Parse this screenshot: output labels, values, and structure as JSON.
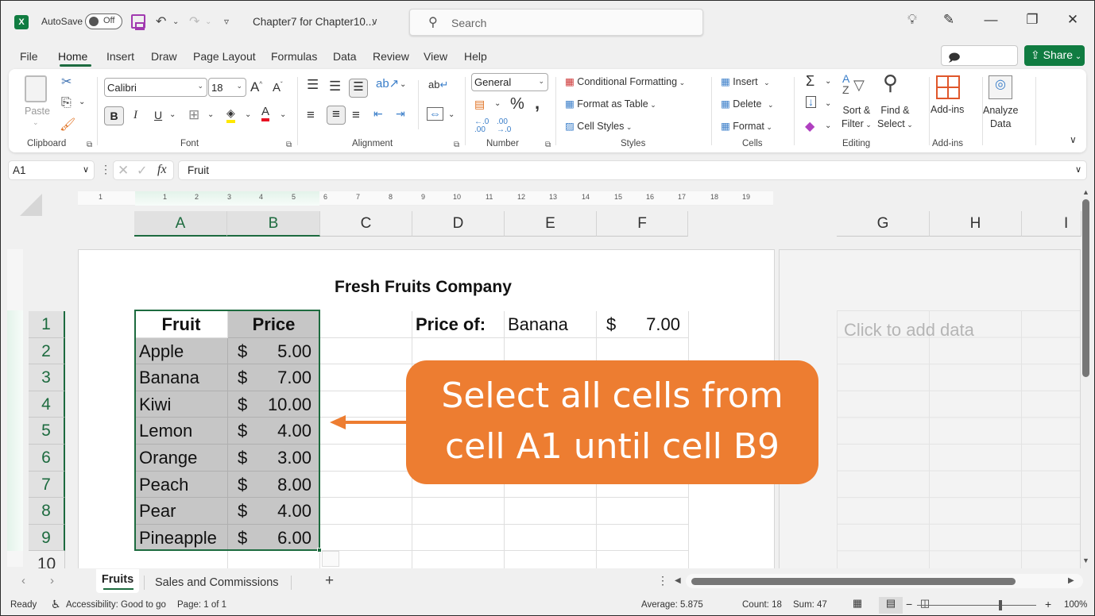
{
  "titlebar": {
    "autosave_label": "AutoSave",
    "autosave_state": "Off",
    "document_title": "Chapter7 for Chapter10...",
    "search_placeholder": "Search"
  },
  "menu": {
    "tabs": [
      "File",
      "Home",
      "Insert",
      "Draw",
      "Page Layout",
      "Formulas",
      "Data",
      "Review",
      "View",
      "Help"
    ],
    "active_tab": "Home",
    "comments_label": "Comments",
    "share_label": "Share"
  },
  "ribbon": {
    "clipboard": {
      "paste_label": "Paste",
      "group_label": "Clipboard"
    },
    "font": {
      "font_name": "Calibri",
      "font_size": "18",
      "group_label": "Font",
      "bold": "B",
      "italic": "I",
      "underline": "U"
    },
    "alignment": {
      "group_label": "Alignment"
    },
    "number": {
      "format": "General",
      "group_label": "Number"
    },
    "styles": {
      "conditional_formatting": "Conditional Formatting",
      "format_as_table": "Format as Table",
      "cell_styles": "Cell Styles",
      "group_label": "Styles"
    },
    "cells": {
      "insert": "Insert",
      "delete": "Delete",
      "format": "Format",
      "group_label": "Cells"
    },
    "editing": {
      "sort_filter_1": "Sort &",
      "sort_filter_2": "Filter",
      "find_select_1": "Find &",
      "find_select_2": "Select",
      "group_label": "Editing"
    },
    "addins": {
      "addins_label": "Add-ins",
      "group_label": "Add-ins"
    },
    "analyze": {
      "label_1": "Analyze",
      "label_2": "Data"
    }
  },
  "formula_bar": {
    "name_box": "A1",
    "formula": "Fruit"
  },
  "ruler": {
    "ticks": [
      "1",
      "1",
      "2",
      "3",
      "4",
      "5",
      "6",
      "7",
      "8",
      "9",
      "10",
      "11",
      "12",
      "13",
      "14",
      "15",
      "16",
      "17",
      "18",
      "19"
    ]
  },
  "columns": [
    "A",
    "B",
    "C",
    "D",
    "E",
    "F",
    "G",
    "H",
    "I"
  ],
  "rows": [
    "1",
    "2",
    "3",
    "4",
    "5",
    "6",
    "7",
    "8",
    "9",
    "10"
  ],
  "sheet": {
    "title": "Fresh Fruits Company",
    "headers": [
      "Fruit",
      "Price"
    ],
    "items": [
      {
        "fruit": "Apple",
        "currency": "$",
        "price": "5.00"
      },
      {
        "fruit": "Banana",
        "currency": "$",
        "price": "7.00"
      },
      {
        "fruit": "Kiwi",
        "currency": "$",
        "price": "10.00"
      },
      {
        "fruit": "Lemon",
        "currency": "$",
        "price": "4.00"
      },
      {
        "fruit": "Orange",
        "currency": "$",
        "price": "3.00"
      },
      {
        "fruit": "Peach",
        "currency": "$",
        "price": "8.00"
      },
      {
        "fruit": "Pear",
        "currency": "$",
        "price": "4.00"
      },
      {
        "fruit": "Pineapple",
        "currency": "$",
        "price": "6.00"
      }
    ],
    "lookup_label": "Price of:",
    "lookup_fruit": "Banana",
    "lookup_currency": "$",
    "lookup_price": "7.00",
    "add_data_hint": "Click to add data"
  },
  "callout": {
    "line1": "Select all cells from",
    "line2": "cell A1 until cell B9",
    "color": "#ed7d31"
  },
  "sheet_tabs": {
    "active": "Fruits",
    "other": "Sales and Commissions"
  },
  "status": {
    "ready": "Ready",
    "accessibility": "Accessibility: Good to go",
    "page": "Page: 1 of 1",
    "average": "Average: 5.875",
    "count": "Count: 18",
    "sum": "Sum: 47",
    "zoom": "100%"
  },
  "colors": {
    "accent": "#1d6b3f",
    "share": "#107c41",
    "callout": "#ed7d31"
  }
}
